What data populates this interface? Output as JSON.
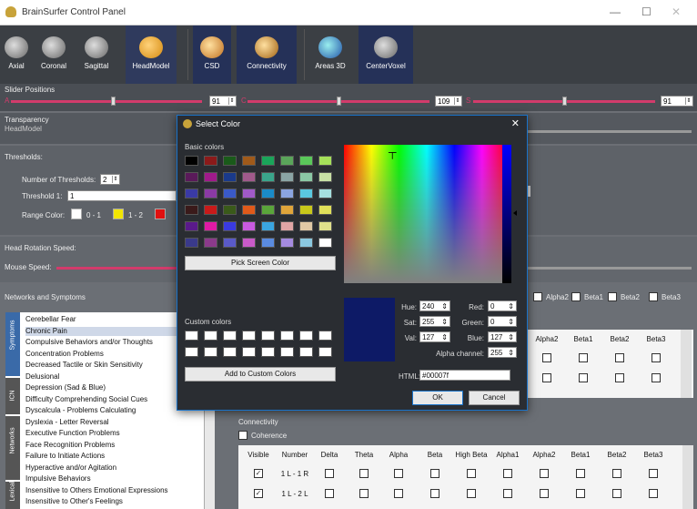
{
  "window": {
    "title": "BrainSurfer Control Panel",
    "min": "—",
    "max": "☐",
    "close": "✕"
  },
  "toolbar": [
    {
      "label": "Axial"
    },
    {
      "label": "Coronal"
    },
    {
      "label": "Sagittal"
    },
    {
      "label": "HeadModel"
    },
    {
      "label": "CSD"
    },
    {
      "label": "Connectivity"
    },
    {
      "label": "Areas 3D"
    },
    {
      "label": "CenterVoxel"
    }
  ],
  "sliders": {
    "title": "Slider Positions",
    "a_label": "A",
    "a_value": "91",
    "c_label": "C",
    "c_value": "109",
    "s_label": "S",
    "s_value": "91"
  },
  "transparency": {
    "title": "Transparency",
    "sub": "HeadModel"
  },
  "thresholds": {
    "title": "Thresholds:",
    "num_label": "Number of Thresholds:",
    "num_value": "2",
    "th1_label": "Threshold 1:",
    "th1_value": "1",
    "range_label": "Range Color:",
    "r1": "0 - 1",
    "r2": "1 - 2",
    "c_white": "#ffffff",
    "c_yellow": "#f2e600",
    "c_red": "#e01010"
  },
  "head_rotation": {
    "title": "Head Rotation Speed:",
    "mouse_label": "Mouse Speed:"
  },
  "networks": {
    "title": "Networks and Symptoms",
    "tabs": [
      "Symptoms",
      "ICN",
      "Networks"
    ],
    "tab_last": "Lexical",
    "items": [
      "Cerebellar Fear",
      "Chronic Pain",
      "Compulsive Behaviors and/or Thoughts",
      "Concentration Problems",
      "Decreased Tactile or Skin Sensitivity",
      "Delusional",
      "Depression (Sad & Blue)",
      "Difficulty Comprehending Social Cues",
      "Dyscalcula - Problems Calculating",
      "Dyslexia - Letter Reversal",
      "Executive Function Problems",
      "Face Recognition Problems",
      "Failure to Initiate Actions",
      "Hyperactive and/or Agitation",
      "Impulsive Behaviors",
      "Insensitive to Others Emotional Expressions",
      "Insensitive to Other's Feelings"
    ]
  },
  "bands": {
    "items": [
      "Alpha2",
      "Beta1",
      "Beta2",
      "Beta3"
    ]
  },
  "upper_grid": {
    "headers": [
      "Alpha2",
      "Beta1",
      "Beta2",
      "Beta3"
    ]
  },
  "connectivity": {
    "title": "Connectivity",
    "coherence": "Coherence",
    "headers": [
      "Visible",
      "Number",
      "Delta",
      "Theta",
      "Alpha",
      "Beta",
      "High Beta",
      "Alpha1",
      "Alpha2",
      "Beta1",
      "Beta2",
      "Beta3"
    ],
    "rows": [
      "1 L - 1 R",
      "1 L - 2 L"
    ]
  },
  "dialog": {
    "title": "Select Color",
    "basic": "Basic colors",
    "pick": "Pick Screen Color",
    "custom": "Custom colors",
    "add": "Add to Custom Colors",
    "hue_l": "Hue:",
    "hue": "240",
    "sat_l": "Sat:",
    "sat": "255",
    "val_l": "Val:",
    "val": "127",
    "red_l": "Red:",
    "red": "0",
    "green_l": "Green:",
    "green": "0",
    "blue_l": "Blue:",
    "blue": "127",
    "alpha_l": "Alpha channel:",
    "alpha": "255",
    "html_l": "HTML:",
    "html": "#00007f",
    "ok": "OK",
    "cancel": "Cancel",
    "current_color": "#0d1a66",
    "swatches": [
      "#000000",
      "#8b1a1a",
      "#1a5a1a",
      "#a05a1a",
      "#1aa55a",
      "#5aa55a",
      "#5ac85a",
      "#a5e05a",
      "#5a1a5a",
      "#a01a8b",
      "#1a3a8b",
      "#a05a8b",
      "#3aa58b",
      "#8ba5a5",
      "#8bc8a5",
      "#c8e0a5",
      "#3a3aa5",
      "#8b3aa5",
      "#3a5ac8",
      "#a05ac8",
      "#1a8bc8",
      "#8ba5e0",
      "#5ac8e0",
      "#a5e0e0",
      "#3a1a1a",
      "#c81a1a",
      "#3a5a1a",
      "#e05a1a",
      "#5aa53a",
      "#e0a53a",
      "#c8c81a",
      "#e0e05a",
      "#5a1a8b",
      "#e01aa5",
      "#3a3ae0",
      "#c85ae0",
      "#3aa5e0",
      "#e0a5a5",
      "#e0c8a5",
      "#e0e08b",
      "#3a3a8b",
      "#8b3a8b",
      "#5a5ac8",
      "#c85ac8",
      "#5a8be0",
      "#a58be0",
      "#8bc8e0",
      "#ffffff"
    ]
  }
}
